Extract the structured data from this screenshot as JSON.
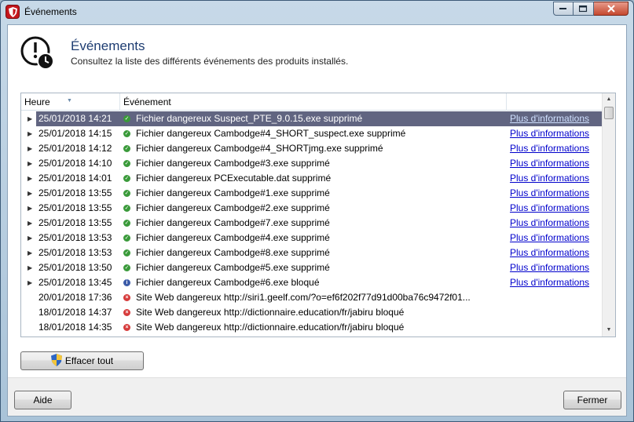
{
  "window": {
    "title": "Événements"
  },
  "header": {
    "title": "Événements",
    "subtitle": "Consultez la liste des différents événements des produits installés."
  },
  "grid": {
    "columns": [
      "Heure",
      "Événement"
    ],
    "link_label": "Plus d'informations",
    "rows": [
      {
        "time": "25/01/2018 14:21",
        "event": "Fichier dangereux Suspect_PTE_9.0.15.exe supprimé",
        "status": "ok",
        "expandable": true,
        "link": true,
        "selected": true
      },
      {
        "time": "25/01/2018 14:15",
        "event": "Fichier dangereux Cambodge#4_SHORT_suspect.exe supprimé",
        "status": "ok",
        "expandable": true,
        "link": true
      },
      {
        "time": "25/01/2018 14:12",
        "event": "Fichier dangereux Cambodge#4_SHORTjmg.exe supprimé",
        "status": "ok",
        "expandable": true,
        "link": true
      },
      {
        "time": "25/01/2018 14:10",
        "event": "Fichier dangereux Cambodge#3.exe supprimé",
        "status": "ok",
        "expandable": true,
        "link": true
      },
      {
        "time": "25/01/2018 14:01",
        "event": "Fichier dangereux PCExecutable.dat supprimé",
        "status": "ok",
        "expandable": true,
        "link": true
      },
      {
        "time": "25/01/2018 13:55",
        "event": "Fichier dangereux Cambodge#1.exe supprimé",
        "status": "ok",
        "expandable": true,
        "link": true
      },
      {
        "time": "25/01/2018 13:55",
        "event": "Fichier dangereux Cambodge#2.exe supprimé",
        "status": "ok",
        "expandable": true,
        "link": true
      },
      {
        "time": "25/01/2018 13:55",
        "event": "Fichier dangereux Cambodge#7.exe supprimé",
        "status": "ok",
        "expandable": true,
        "link": true
      },
      {
        "time": "25/01/2018 13:53",
        "event": "Fichier dangereux Cambodge#4.exe supprimé",
        "status": "ok",
        "expandable": true,
        "link": true
      },
      {
        "time": "25/01/2018 13:53",
        "event": "Fichier dangereux Cambodge#8.exe supprimé",
        "status": "ok",
        "expandable": true,
        "link": true
      },
      {
        "time": "25/01/2018 13:50",
        "event": "Fichier dangereux Cambodge#5.exe supprimé",
        "status": "ok",
        "expandable": true,
        "link": true
      },
      {
        "time": "25/01/2018 13:45",
        "event": "Fichier dangereux Cambodge#6.exe bloqué",
        "status": "info",
        "expandable": true,
        "link": true
      },
      {
        "time": "20/01/2018 17:36",
        "event": "Site Web dangereux http://siri1.geelf.com/?o=ef6f202f77d91d00ba76c9472f01...",
        "status": "blocked",
        "expandable": false,
        "link": false
      },
      {
        "time": "18/01/2018 14:37",
        "event": "Site Web dangereux http://dictionnaire.education/fr/jabiru bloqué",
        "status": "blocked",
        "expandable": false,
        "link": false
      },
      {
        "time": "18/01/2018 14:35",
        "event": "Site Web dangereux http://dictionnaire.education/fr/jabiru bloqué",
        "status": "blocked",
        "expandable": false,
        "link": false
      }
    ]
  },
  "buttons": {
    "clear": "Effacer tout",
    "help": "Aide",
    "close": "Fermer"
  },
  "colors": {
    "ok": "#3a9a3a",
    "info": "#3b5ba8",
    "blocked": "#d63b3b",
    "selection": "#616581",
    "link": "#0000cc",
    "title": "#1e3d72"
  }
}
